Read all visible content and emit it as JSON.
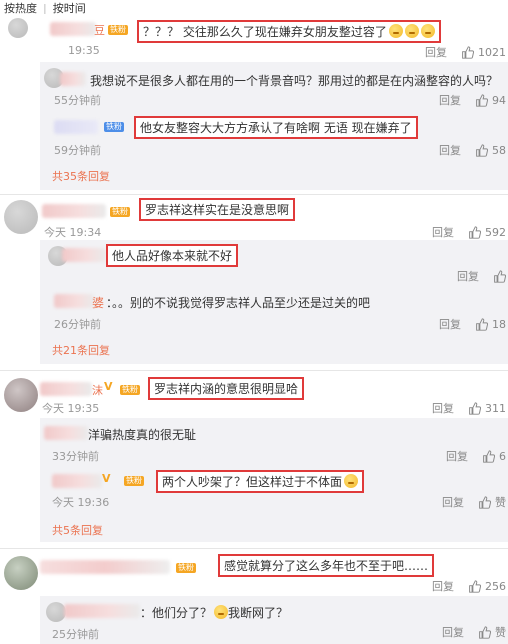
{
  "sort": {
    "hot": "按热度",
    "sep": "|",
    "time": "按时间"
  },
  "labels": {
    "reply": "回复",
    "like_zan": "赞"
  },
  "comments": [
    {
      "name_partial": "豆",
      "badge": "铁粉",
      "content": "？？？ 交往那么久了现在嫌弃女朋友整过容了",
      "time": "19:35",
      "likes": "1021",
      "replies": [
        {
          "content": "我想说不是很多人都在用的一个背景音吗？那用过的都是在内涵整容的人吗？",
          "time": "55分钟前",
          "likes": "94"
        },
        {
          "badge": "铁粉",
          "content": "他女友整容大大方方承认了有啥啊 无语 现在嫌弃了",
          "time": "59分钟前",
          "likes": "58"
        }
      ],
      "expand": "共35条回复"
    },
    {
      "badge": "铁粉",
      "content": "罗志祥这样实在是没意思啊",
      "time": "今天 19:34",
      "likes": "592",
      "replies": [
        {
          "content": "他人品好像本来就不好",
          "time": "",
          "likes": ""
        },
        {
          "name_partial": "婆",
          "content": "：。。别的不说我觉得罗志祥人品至少还是过关的吧",
          "time": "26分钟前",
          "likes": "18"
        }
      ],
      "expand": "共21条回复"
    },
    {
      "name_partial": "沫",
      "badge": "铁粉",
      "content": "罗志祥内涵的意思很明显哈",
      "time": "今天 19:35",
      "likes": "311",
      "replies": [
        {
          "content": "洋骗热度真的很无耻",
          "time": "33分钟前",
          "likes": "6"
        },
        {
          "badge": "铁粉",
          "content": "两个人吵架了？但这样过于不体面",
          "time": "今天 19:36",
          "likes": ""
        }
      ],
      "expand": "共5条回复"
    },
    {
      "badge": "铁粉",
      "content": "感觉就算分了这么多年也不至于吧……",
      "time": "",
      "likes": "256",
      "replies": [
        {
          "content": "：他们分了？",
          "content2": "我断网了？",
          "time": "25分钟前",
          "likes": ""
        }
      ]
    }
  ],
  "colors": {
    "highlight_box": "#e03a3a",
    "expand_link": "#eb7350",
    "reply_bg": "#f2f2f5",
    "badge": "#ff8200"
  }
}
